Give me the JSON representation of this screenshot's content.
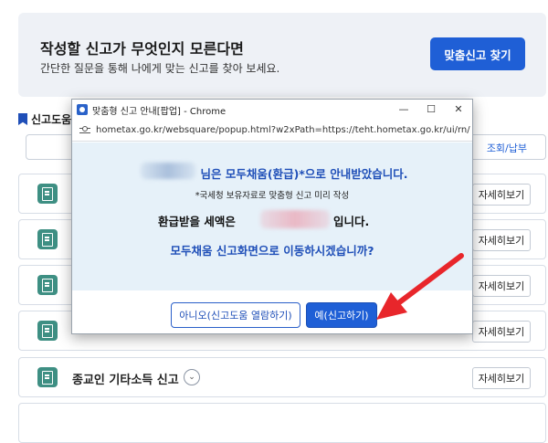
{
  "banner": {
    "title": "작성할 신고가 무엇인지 모른다면",
    "subtitle": "간단한 질문을 통해 나에게 맞는 신고를 찾아 보세요.",
    "button": "맞춤신고 찾기"
  },
  "section": {
    "title": "신고도움",
    "filter_right": "조회/납부"
  },
  "rows": [
    {
      "label": "",
      "detail": "자세히보기"
    },
    {
      "label": "",
      "detail": "자세히보기"
    },
    {
      "label": "",
      "detail": "자세히보기"
    },
    {
      "label": "",
      "detail": "자세히보기"
    },
    {
      "label": "종교인 기타소득 신고",
      "detail": "자세히보기"
    }
  ],
  "popup": {
    "window_title": "맞춤형 신고 안내[팝업] - Chrome",
    "url": "hometax.go.kr/websquare/popup.html?w2xPath=https://teht.hometax.go.kr/ui/rn/a/a...",
    "message_line1": "님은 모두채움(환급)*으로 안내받았습니다.",
    "note": "*국세청 보유자료로 맞춤형 신고 미리 작성",
    "refund_label": "환급받을 세액은",
    "refund_suffix": "입니다.",
    "question": "모두채움 신고화면으로 이동하시겠습니까?",
    "btn_no": "아니오(신고도움 열람하기)",
    "btn_yes": "예(신고하기)"
  },
  "colors": {
    "accent": "#1f5fd6",
    "annotation_arrow": "#e8262b"
  }
}
